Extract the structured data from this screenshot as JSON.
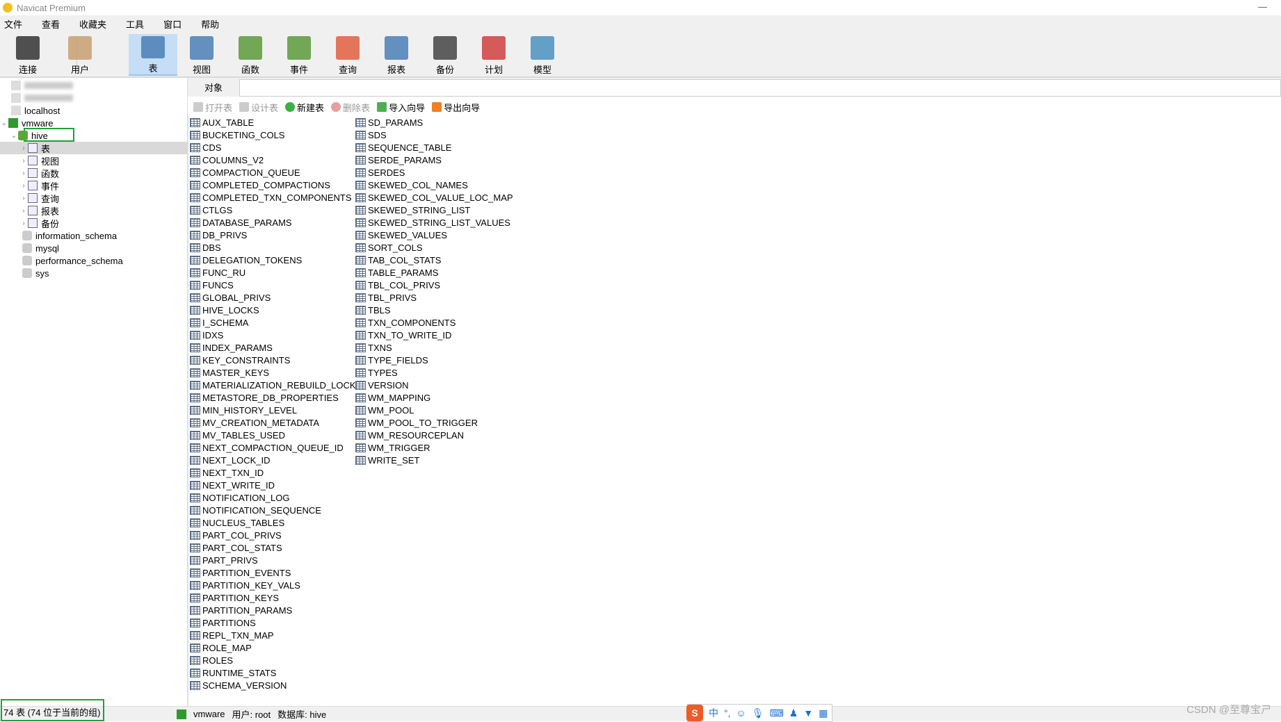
{
  "app": {
    "title": "Navicat Premium"
  },
  "menu": [
    "文件",
    "查看",
    "收藏夹",
    "工具",
    "窗口",
    "帮助"
  ],
  "toolbar": [
    {
      "label": "连接",
      "icon": "connection-icon"
    },
    {
      "label": "用户",
      "icon": "user-icon"
    },
    {
      "label": "表",
      "icon": "table-icon",
      "active": true
    },
    {
      "label": "视图",
      "icon": "view-icon"
    },
    {
      "label": "函数",
      "icon": "function-icon"
    },
    {
      "label": "事件",
      "icon": "event-icon"
    },
    {
      "label": "查询",
      "icon": "query-icon"
    },
    {
      "label": "报表",
      "icon": "report-icon"
    },
    {
      "label": "备份",
      "icon": "backup-icon"
    },
    {
      "label": "计划",
      "icon": "schedule-icon"
    },
    {
      "label": "模型",
      "icon": "model-icon"
    }
  ],
  "tree": {
    "localhost": "localhost",
    "vmware": "vmware",
    "hive": "hive",
    "children": [
      "表",
      "视图",
      "函数",
      "事件",
      "查询",
      "报表",
      "备份"
    ],
    "dbs": [
      "information_schema",
      "mysql",
      "performance_schema",
      "sys"
    ]
  },
  "tab": "对象",
  "actions": [
    "打开表",
    "设计表",
    "新建表",
    "删除表",
    "导入向导",
    "导出向导"
  ],
  "tables_col1": [
    "AUX_TABLE",
    "BUCKETING_COLS",
    "CDS",
    "COLUMNS_V2",
    "COMPACTION_QUEUE",
    "COMPLETED_COMPACTIONS",
    "COMPLETED_TXN_COMPONENTS",
    "CTLGS",
    "DATABASE_PARAMS",
    "DB_PRIVS",
    "DBS",
    "DELEGATION_TOKENS",
    "FUNC_RU",
    "FUNCS",
    "GLOBAL_PRIVS",
    "HIVE_LOCKS",
    "I_SCHEMA",
    "IDXS",
    "INDEX_PARAMS",
    "KEY_CONSTRAINTS",
    "MASTER_KEYS",
    "MATERIALIZATION_REBUILD_LOCKS",
    "METASTORE_DB_PROPERTIES",
    "MIN_HISTORY_LEVEL",
    "MV_CREATION_METADATA",
    "MV_TABLES_USED",
    "NEXT_COMPACTION_QUEUE_ID",
    "NEXT_LOCK_ID",
    "NEXT_TXN_ID",
    "NEXT_WRITE_ID",
    "NOTIFICATION_LOG",
    "NOTIFICATION_SEQUENCE",
    "NUCLEUS_TABLES",
    "PART_COL_PRIVS",
    "PART_COL_STATS",
    "PART_PRIVS",
    "PARTITION_EVENTS",
    "PARTITION_KEY_VALS",
    "PARTITION_KEYS",
    "PARTITION_PARAMS",
    "PARTITIONS",
    "REPL_TXN_MAP",
    "ROLE_MAP",
    "ROLES",
    "RUNTIME_STATS",
    "SCHEMA_VERSION"
  ],
  "tables_col2": [
    "SD_PARAMS",
    "SDS",
    "SEQUENCE_TABLE",
    "SERDE_PARAMS",
    "SERDES",
    "SKEWED_COL_NAMES",
    "SKEWED_COL_VALUE_LOC_MAP",
    "SKEWED_STRING_LIST",
    "SKEWED_STRING_LIST_VALUES",
    "SKEWED_VALUES",
    "SORT_COLS",
    "TAB_COL_STATS",
    "TABLE_PARAMS",
    "TBL_COL_PRIVS",
    "TBL_PRIVS",
    "TBLS",
    "TXN_COMPONENTS",
    "TXN_TO_WRITE_ID",
    "TXNS",
    "TYPE_FIELDS",
    "TYPES",
    "VERSION",
    "WM_MAPPING",
    "WM_POOL",
    "WM_POOL_TO_TRIGGER",
    "WM_RESOURCEPLAN",
    "WM_TRIGGER",
    "WRITE_SET"
  ],
  "status": {
    "count": "74 表 (74 位于当前的组)",
    "connection": "vmware",
    "user": "用户: root",
    "database": "数据库: hive"
  },
  "ime": {
    "lang": "中"
  },
  "watermark": "CSDN @至尊宝ㄕ"
}
